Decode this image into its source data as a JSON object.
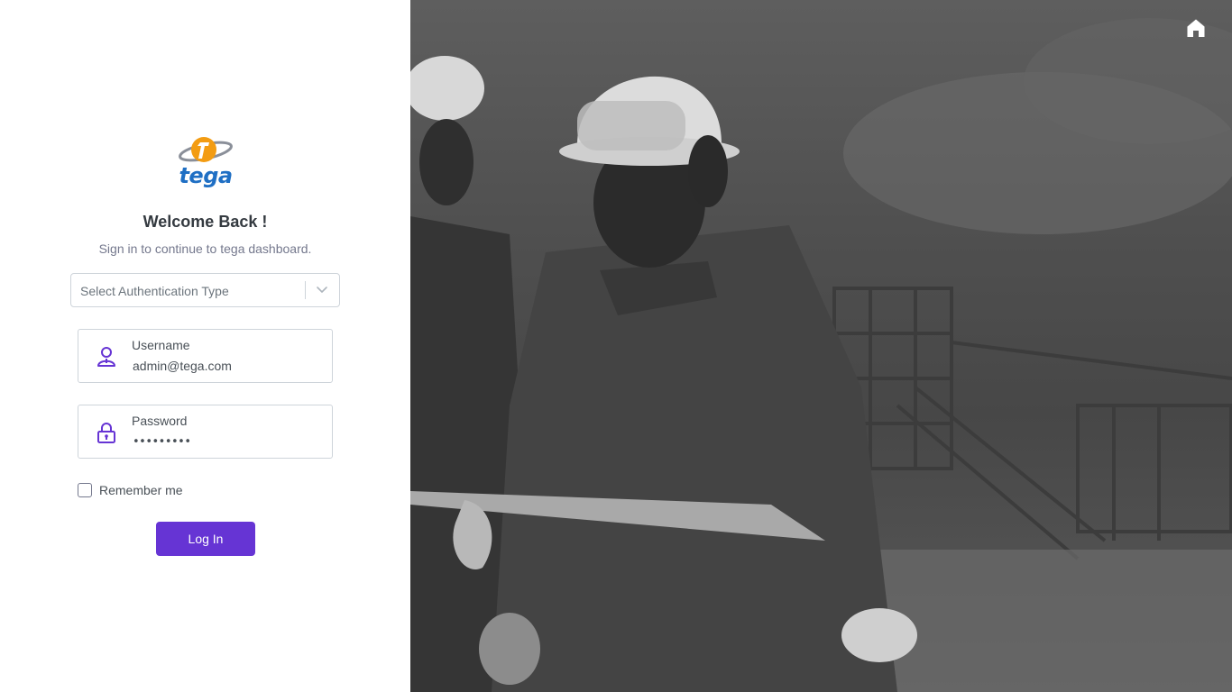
{
  "brand": {
    "logo_text": "tega",
    "logo_accent": "#f39c12",
    "logo_text_color": "#1f6fc4"
  },
  "login": {
    "title": "Welcome Back !",
    "subtitle": "Sign in to continue to tega dashboard.",
    "auth_select": {
      "placeholder": "Select Authentication Type",
      "icon": "chevron-down-icon"
    },
    "username": {
      "label": "Username",
      "value": "admin@tega.com",
      "icon": "user-icon"
    },
    "password": {
      "label": "Password",
      "value": "•••••••••",
      "icon": "lock-icon"
    },
    "remember_label": "Remember me",
    "login_button": "Log In"
  },
  "hero": {
    "home_icon": "home-icon"
  },
  "colors": {
    "primary": "#6634d4",
    "icon_purple": "#6634d4",
    "text_dark": "#343a40",
    "text_muted": "#74788d"
  }
}
